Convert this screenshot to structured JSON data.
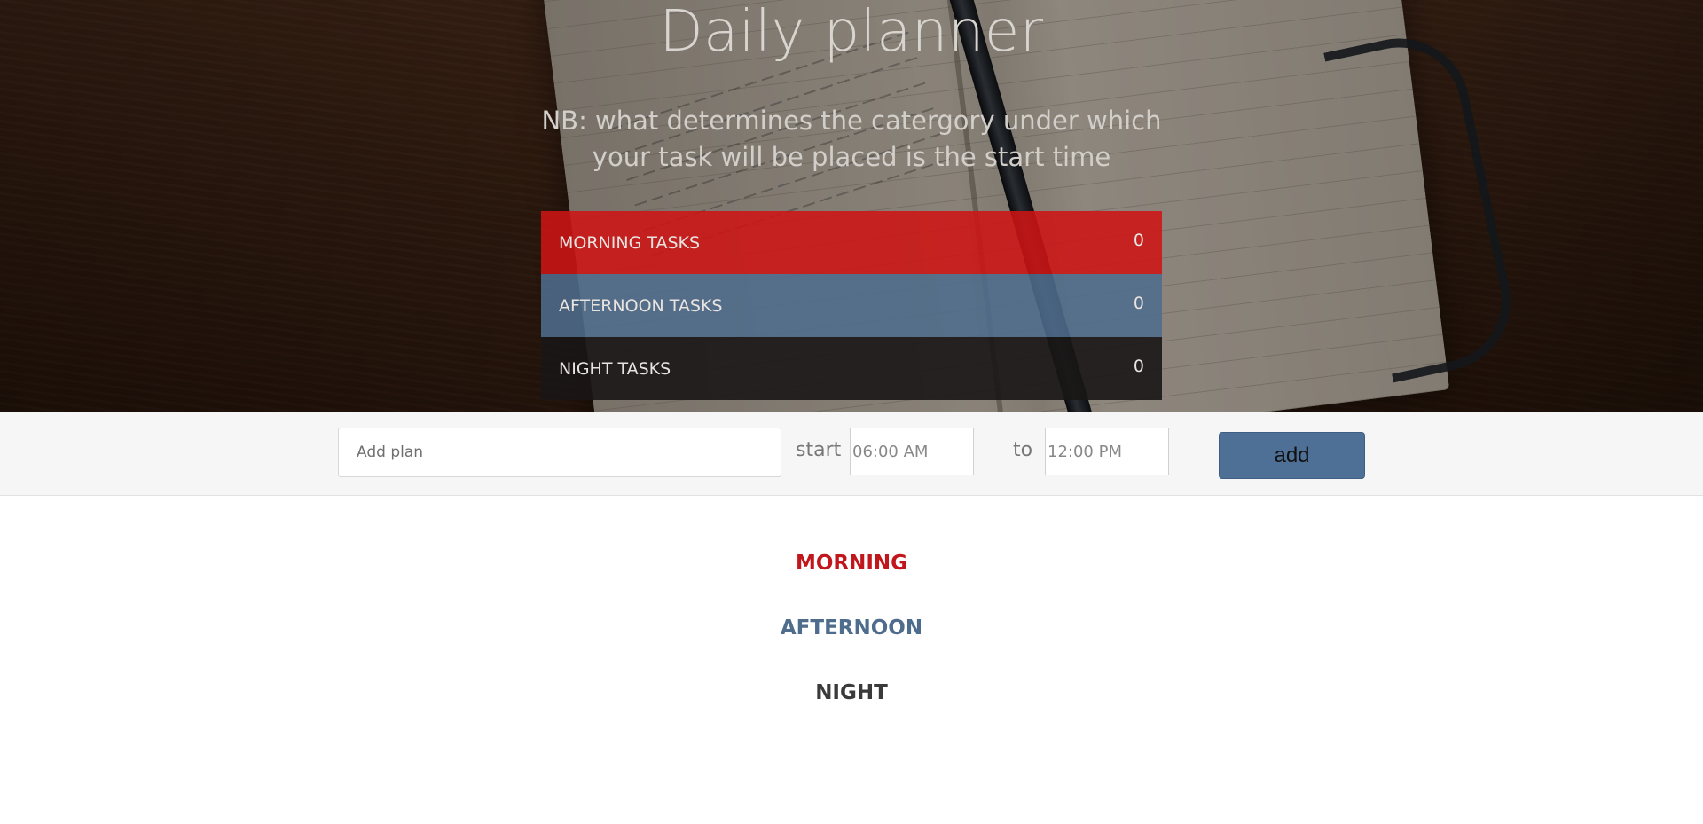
{
  "header": {
    "title": "Daily planner",
    "note": "NB: what determines the catergory under which your task will be placed is the start time"
  },
  "summary": [
    {
      "label": "MORNING TASKS",
      "count": "0",
      "color": "#cd1414"
    },
    {
      "label": "AFTERNOON TASKS",
      "count": "0",
      "color": "#4e6c8c"
    },
    {
      "label": "NIGHT TASKS",
      "count": "0",
      "color": "#191616"
    }
  ],
  "form": {
    "plan_placeholder": "Add plan",
    "start_label": "start",
    "start_value": "06:00 AM",
    "to_label": "to",
    "end_value": "12:00 PM",
    "add_label": "add",
    "accent": "#4e7096"
  },
  "categories": [
    {
      "label": "MORNING",
      "color": "#c0161c"
    },
    {
      "label": "AFTERNOON",
      "color": "#4e6c8c"
    },
    {
      "label": "NIGHT",
      "color": "#3a3a3a"
    }
  ]
}
